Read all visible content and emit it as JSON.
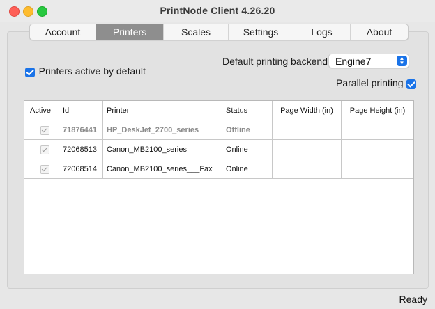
{
  "window": {
    "title": "PrintNode Client 4.26.20"
  },
  "tabs": [
    {
      "label": "Account",
      "active": false
    },
    {
      "label": "Printers",
      "active": true
    },
    {
      "label": "Scales",
      "active": false
    },
    {
      "label": "Settings",
      "active": false
    },
    {
      "label": "Logs",
      "active": false
    },
    {
      "label": "About",
      "active": false
    }
  ],
  "options": {
    "printers_active_label": "Printers active by default",
    "printers_active_checked": true,
    "backend_label": "Default printing backend",
    "backend_value": "Engine7",
    "parallel_label": "Parallel printing",
    "parallel_checked": true
  },
  "table": {
    "headers": [
      "Active",
      "Id",
      "Printer",
      "Status",
      "Page Width (in)",
      "Page Height (in)"
    ],
    "rows": [
      {
        "active": true,
        "id": "71876441",
        "printer": "HP_DeskJet_2700_series",
        "status": "Offline",
        "page_width": "",
        "page_height": ""
      },
      {
        "active": true,
        "id": "72068513",
        "printer": "Canon_MB2100_series",
        "status": "Online",
        "page_width": "",
        "page_height": ""
      },
      {
        "active": true,
        "id": "72068514",
        "printer": "Canon_MB2100_series___Fax",
        "status": "Online",
        "page_width": "",
        "page_height": ""
      }
    ]
  },
  "status_bar": {
    "text": "Ready"
  },
  "colors": {
    "accent": "#1a73e8",
    "active_tab": "#8e8e8e",
    "offline_text": "#8a8a8a"
  }
}
